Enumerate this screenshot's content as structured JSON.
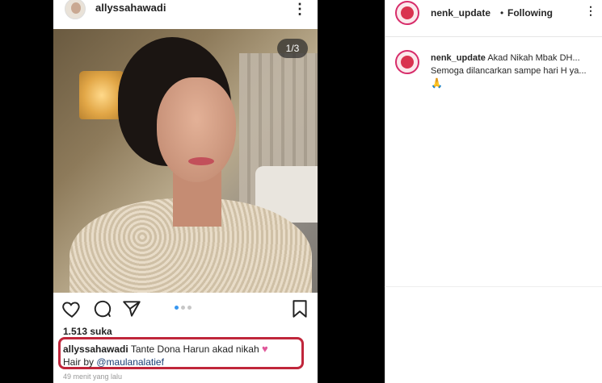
{
  "post": {
    "username": "allyssahawadi",
    "image_counter": "1/3",
    "likes": "1.513 suka",
    "caption_user": "allyssahawadi",
    "caption_text": "Tante Dona Harun akad nikah",
    "caption_line2_prefix": "Hair by ",
    "caption_mention": "@maulanalatief",
    "time": "49 menit yang lalu",
    "icons": {
      "more": "more-vertical-icon",
      "like": "heart-outline-icon",
      "comment": "comment-bubble-icon",
      "share": "paper-plane-icon",
      "save": "bookmark-icon",
      "emoji": "pink-heart-emoji"
    }
  },
  "panel": {
    "header_user": "nenk_update",
    "header_dot": "•",
    "header_follow": "Following",
    "comment_user": "nenk_update",
    "comment_text": "Akad Nikah Mbak DH...",
    "comment_line2": "Semoga dilancarkan sampe hari H ya...",
    "comment_emoji": "🙏"
  },
  "colors": {
    "caption_highlight": "#c0263b",
    "mention": "#1a3d73",
    "avatar_ring": "#d72c6a"
  }
}
